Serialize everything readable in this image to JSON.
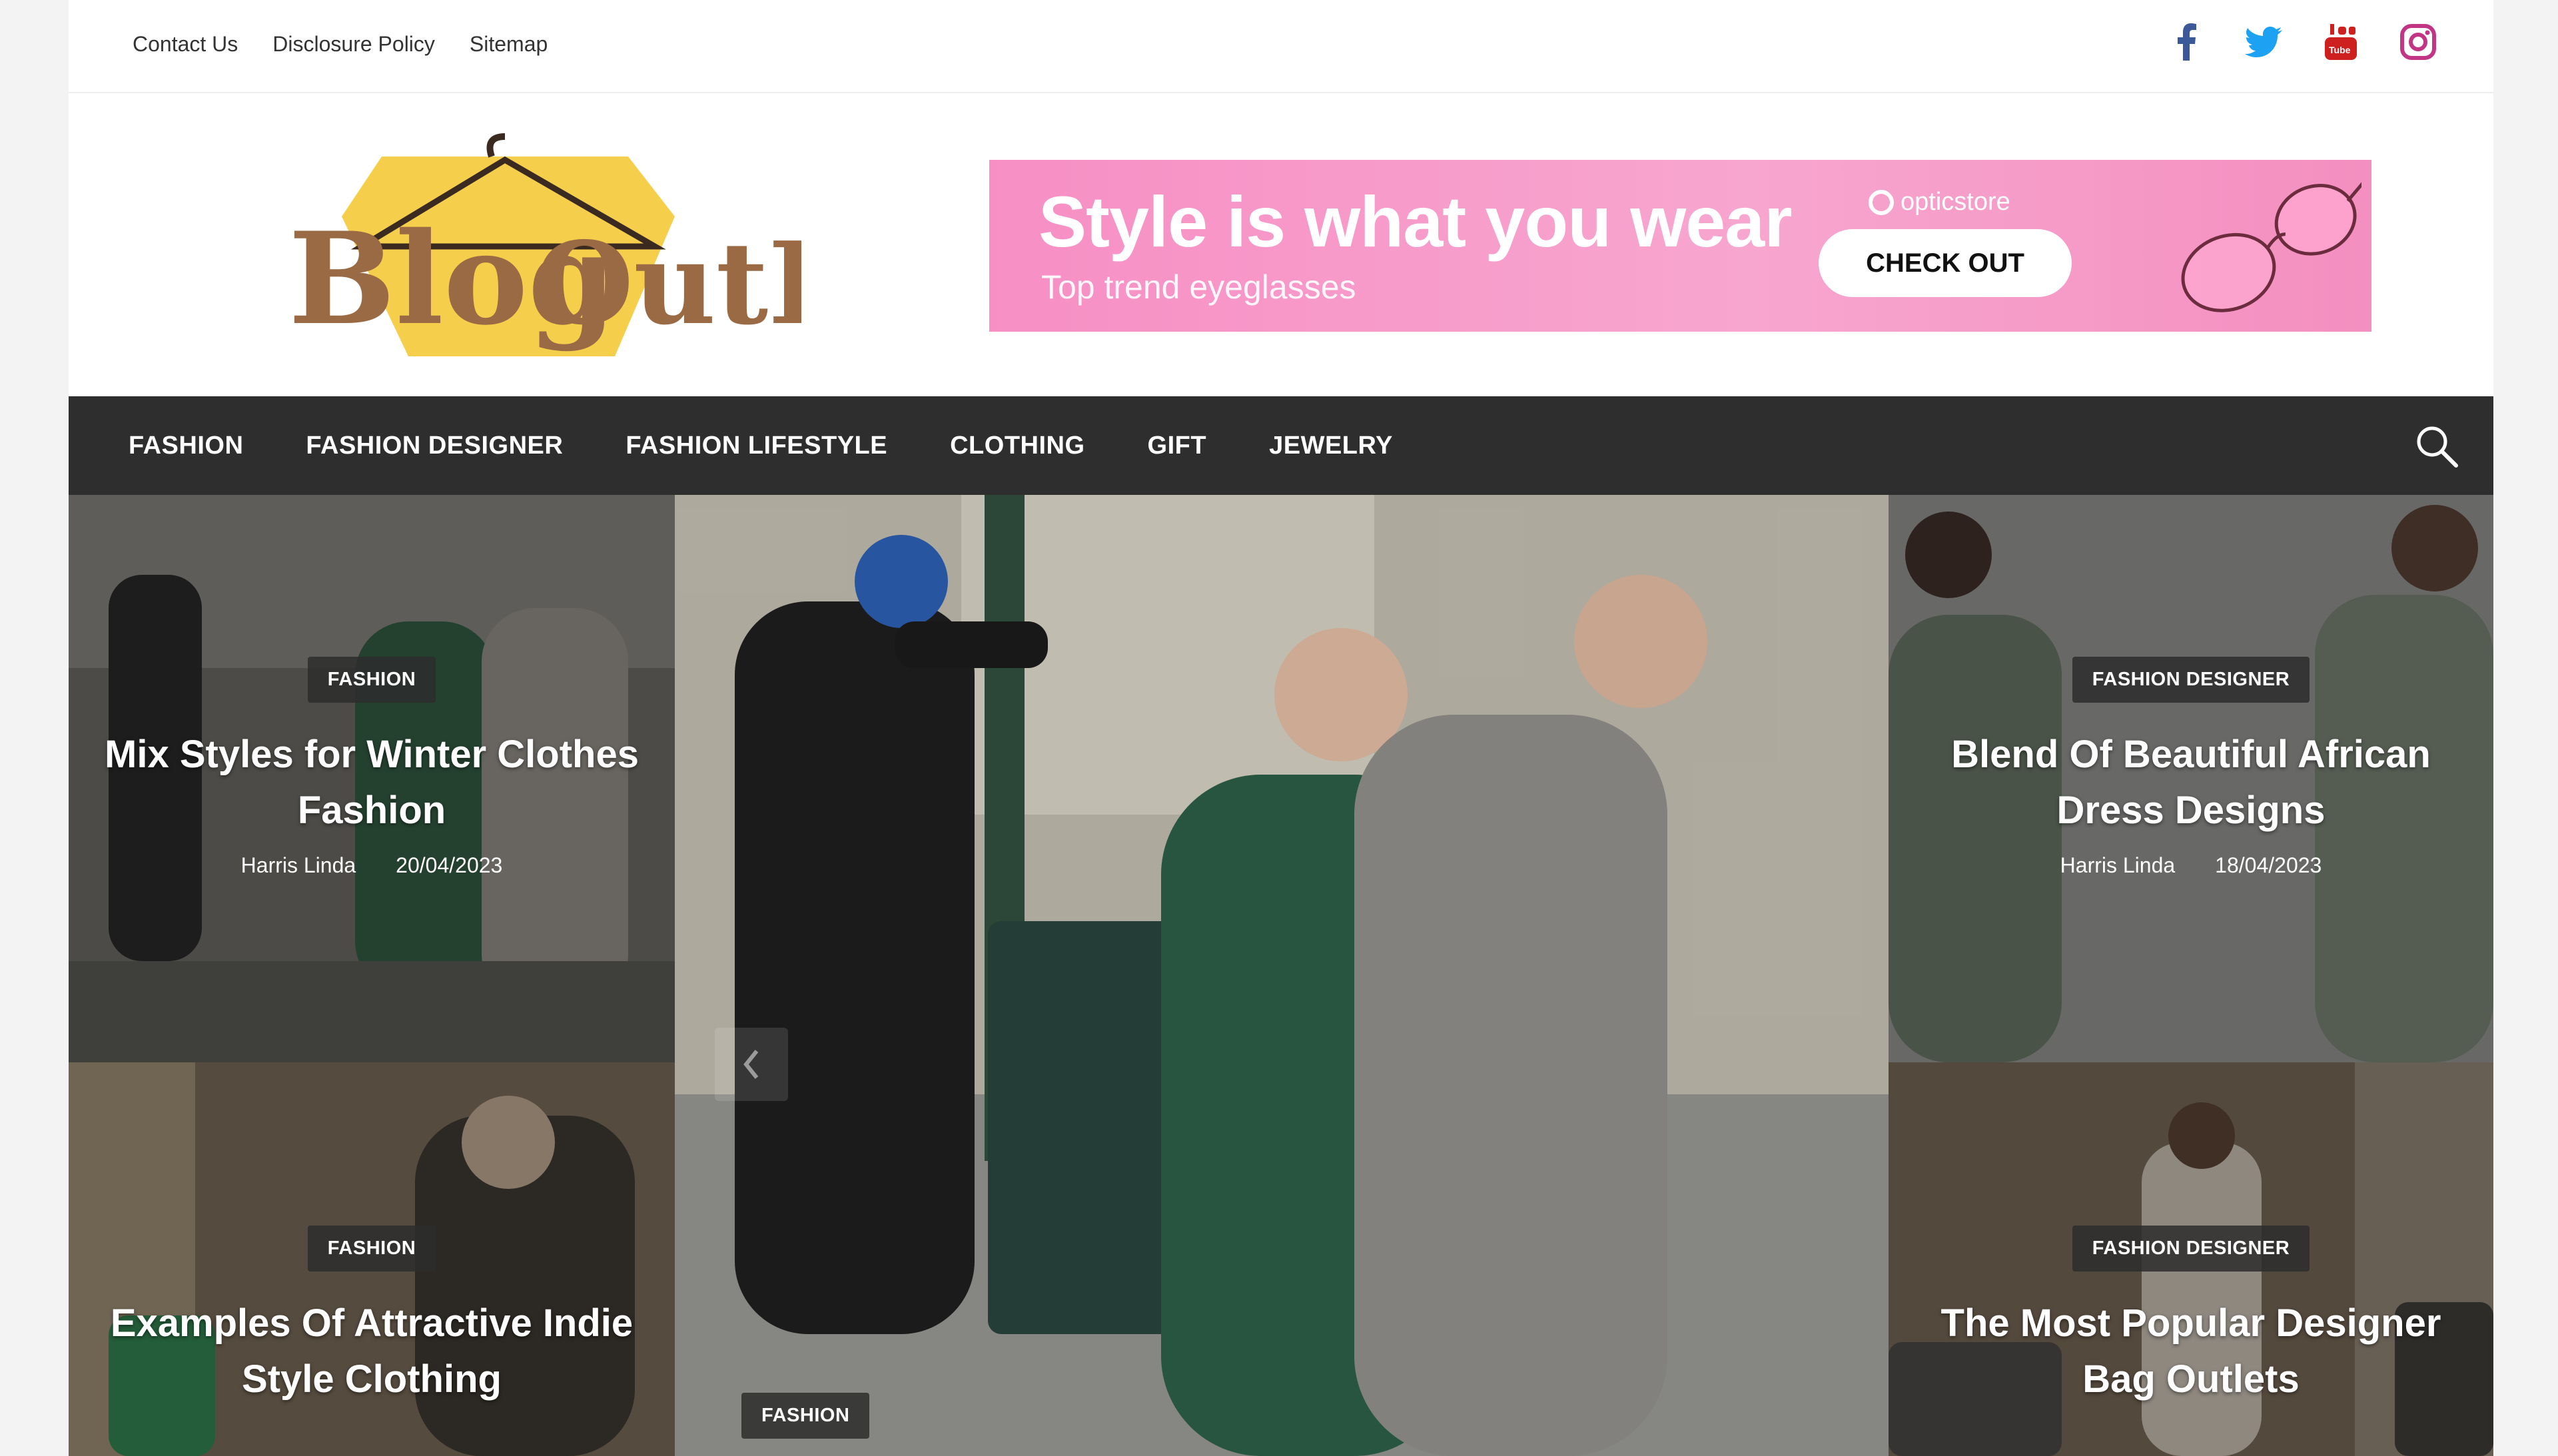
{
  "topbar": {
    "links": [
      "Contact Us",
      "Disclosure Policy",
      "Sitemap"
    ],
    "social": [
      "facebook-icon",
      "twitter-icon",
      "youtube-icon",
      "instagram-icon"
    ]
  },
  "brand": {
    "logo_text": "BlogOutFit",
    "colors": {
      "brown": "#8b5a3c",
      "yellow": "#f5cf4c"
    }
  },
  "banner": {
    "title": "Style is what you wear",
    "subtitle": "Top trend eyeglasses",
    "brand": "opticstore",
    "cta": "CHECK OUT",
    "color": "#f78fc4"
  },
  "nav": {
    "items": [
      "FASHION",
      "FASHION DESIGNER",
      "FASHION LIFESTYLE",
      "CLOTHING",
      "GIFT",
      "JEWELRY"
    ],
    "search_icon": "search-icon",
    "background": "#2e2e2e"
  },
  "posts": {
    "top_left": {
      "category": "FASHION",
      "title": "Mix Styles for Winter Clothes Fashion",
      "author": "Harris Linda",
      "date": "20/04/2023"
    },
    "center": {
      "category": "FASHION"
    },
    "top_right": {
      "category": "FASHION DESIGNER",
      "title": "Blend Of Beautiful African Dress Designs",
      "author": "Harris Linda",
      "date": "18/04/2023"
    },
    "bottom_left": {
      "category": "FASHION",
      "title": "Examples Of Attractive Indie Style Clothing"
    },
    "bottom_right": {
      "category": "FASHION DESIGNER",
      "title": "The Most Popular Designer Bag Outlets"
    }
  }
}
